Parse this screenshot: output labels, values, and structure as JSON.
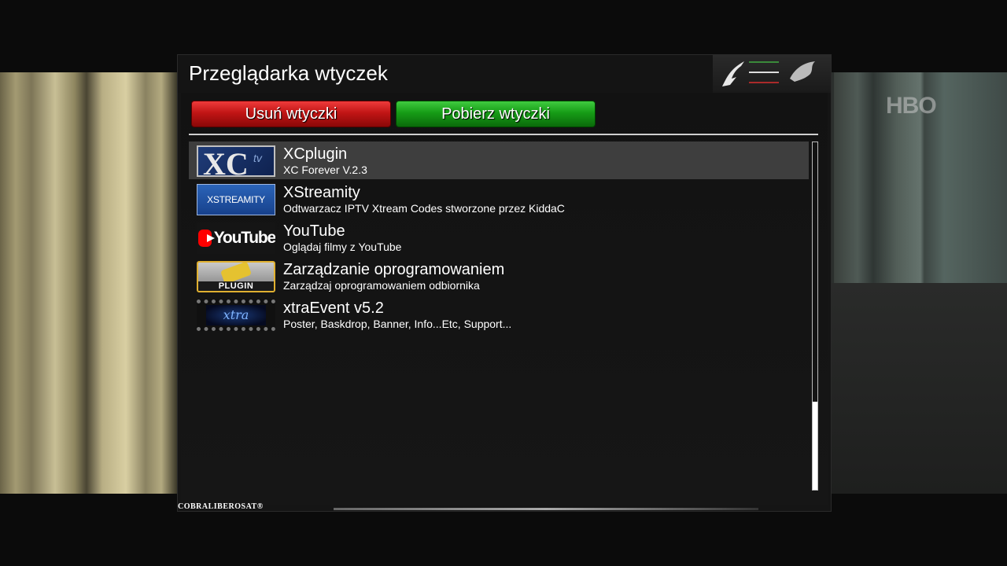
{
  "background": {
    "watermark": "HBO"
  },
  "header": {
    "title": "Przeglądarka wtyczek"
  },
  "buttons": {
    "red_label": "Usuń wtyczki",
    "green_label": "Pobierz wtyczki"
  },
  "plugins": [
    {
      "name": "XCplugin",
      "description": "XC Forever V.2.3",
      "thumb_text": "XC",
      "thumb_sub": "tv",
      "selected": true
    },
    {
      "name": "XStreamity",
      "description": "Odtwarzacz IPTV Xtream Codes stworzone przez KiddaC",
      "thumb_text": "XSTREAMITY"
    },
    {
      "name": "YouTube",
      "description": "Oglądaj filmy z YouTube",
      "thumb_text": "YouTube"
    },
    {
      "name": "Zarządzanie oprogramowaniem",
      "description": "Zarządzaj oprogramowaniem odbiornika",
      "thumb_text": "PLUGIN"
    },
    {
      "name": "xtraEvent v5.2",
      "description": "Poster, Baskdrop, Banner, Info...Etc, Support...",
      "thumb_text": "xtra"
    }
  ],
  "footer": {
    "brand": "COBRALIBEROSAT®"
  },
  "colors": {
    "red_button": "#c11515",
    "green_button": "#169c16",
    "selection": "#3e3e3e"
  }
}
